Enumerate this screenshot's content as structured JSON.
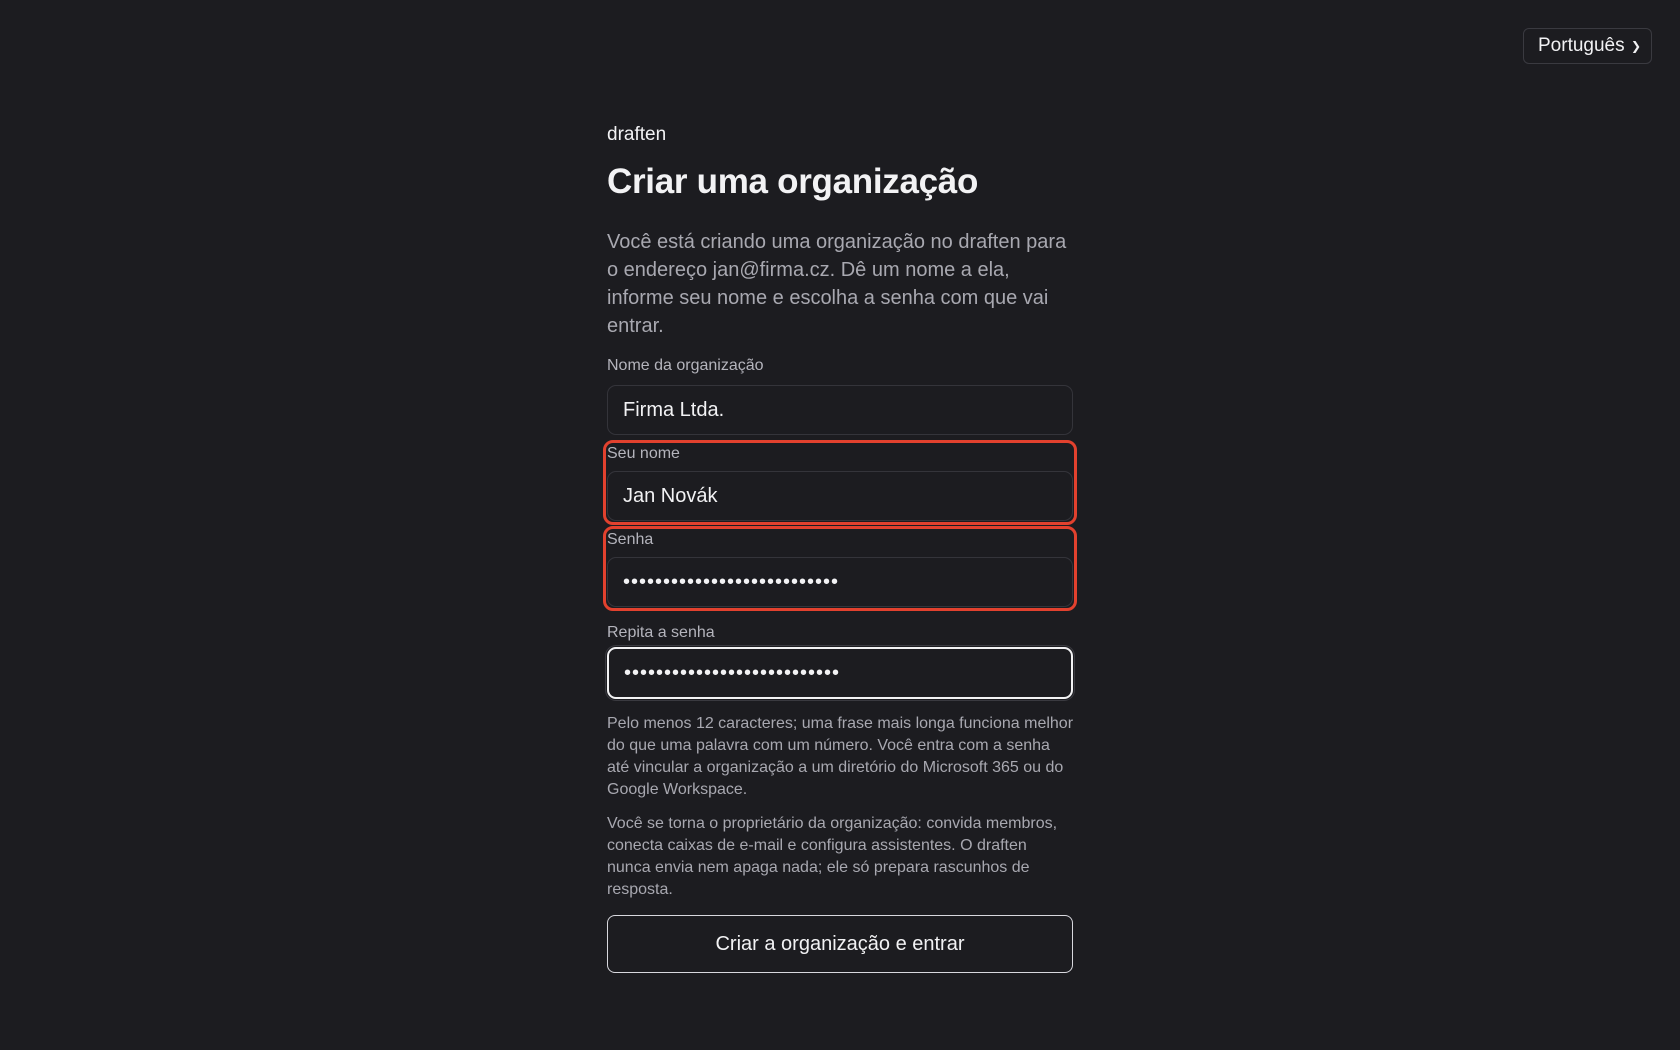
{
  "language_select": {
    "selected": "Português"
  },
  "brand": "draften",
  "title": "Criar uma organização",
  "intro": "Você está criando uma organização no draften para o endereço jan@firma.cz. Dê um nome a ela, informe seu nome e escolha a senha com que vai entrar.",
  "form": {
    "org_name": {
      "label": "Nome da organização",
      "value": "Firma Ltda."
    },
    "your_name": {
      "label": "Seu nome",
      "value": "Jan Novák"
    },
    "password": {
      "label": "Senha",
      "value": "•••••••••••••••••••••••••••"
    },
    "password_repeat": {
      "label": "Repita a senha",
      "value": "•••••••••••••••••••••••••••"
    }
  },
  "password_hint": "Pelo menos 12 caracteres; uma frase mais longa funciona melhor do que uma palavra com um número. Você entra com a senha até vincular a organização a um diretório do Microsoft 365 ou do Google Workspace.",
  "owner_note": "Você se torna o proprietário da organização: convida membros, conecta caixas de e-mail e configura assistentes. O draften nunca envia nem apaga nada; ele só prepara rascunhos de resposta.",
  "submit_label": "Criar a organização e entrar",
  "colors": {
    "background": "#1c1c20",
    "error_outline": "#e2412e",
    "muted_text": "#a8a8b0"
  }
}
